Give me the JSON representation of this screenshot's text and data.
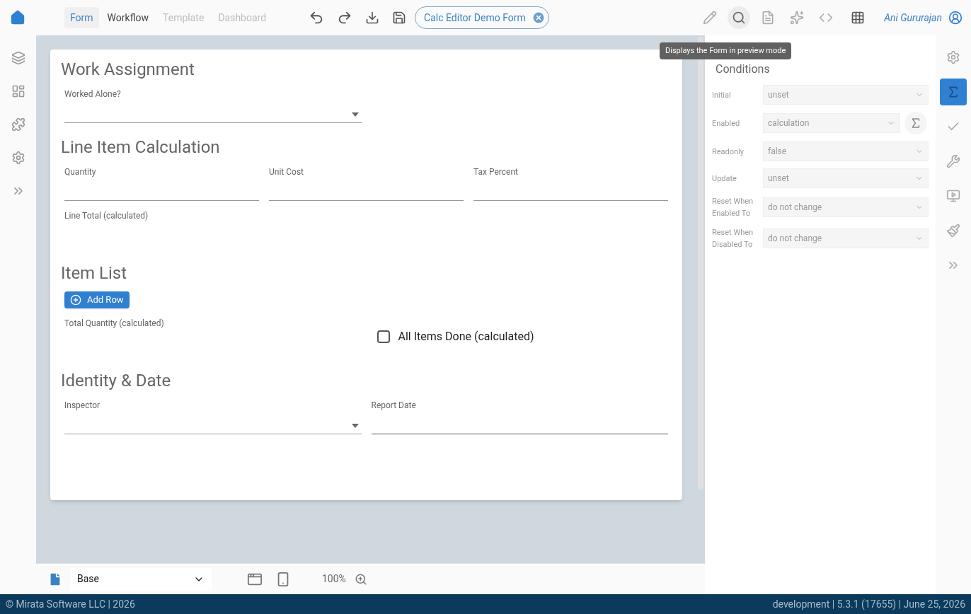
{
  "top_bar": {
    "tabs": [
      {
        "label": "Form",
        "selected": true,
        "disabled": false
      },
      {
        "label": "Workflow",
        "selected": false,
        "disabled": false
      },
      {
        "label": "Template",
        "selected": false,
        "disabled": true
      },
      {
        "label": "Dashboard",
        "selected": false,
        "disabled": true
      }
    ],
    "document": {
      "label": "Calc Editor Demo Form"
    },
    "tools": [
      {
        "selected": false
      },
      {
        "selected": true
      },
      {
        "selected": false
      },
      {
        "selected": false
      },
      {
        "selected": false
      }
    ],
    "user": {
      "name": "Ani Gururajan"
    },
    "tooltip": {
      "text": "Displays the Form in preview mode"
    }
  },
  "form": {
    "sections": [
      {
        "title": "Work Assignment",
        "rows": [
          [
            {
              "kind": "select",
              "label": "Worked Alone?"
            }
          ]
        ]
      },
      {
        "title": "Line Item Calculation",
        "rows": [
          [
            {
              "kind": "text",
              "label": "Quantity"
            },
            {
              "kind": "text",
              "label": "Unit Cost"
            },
            {
              "kind": "text",
              "label": "Tax Percent"
            }
          ],
          [
            {
              "kind": "calculated",
              "label": "Line Total (calculated)"
            }
          ]
        ]
      },
      {
        "title": "Item List",
        "rows": [
          [
            {
              "kind": "button",
              "label": "Add Row"
            }
          ],
          [
            {
              "kind": "calculated",
              "label": "Total Quantity (calculated)"
            },
            {
              "kind": "checkbox",
              "label": "All Items Done (calculated)",
              "checked": false
            }
          ]
        ]
      },
      {
        "title": "Identity & Date",
        "rows": [
          [
            {
              "kind": "select",
              "label": "Inspector"
            },
            {
              "kind": "date",
              "label": "Report Date"
            }
          ]
        ]
      }
    ]
  },
  "bottom_bar": {
    "layout": {
      "value": "Base"
    },
    "zoom": "100%"
  },
  "properties": {
    "title": "Conditions",
    "rows": [
      {
        "label": "Initial",
        "value": "unset",
        "calc_button": false
      },
      {
        "label": "Enabled",
        "value": "calculation",
        "calc_button": true
      },
      {
        "label": "Readonly",
        "value": "false",
        "calc_button": false
      },
      {
        "label": "Update",
        "value": "unset",
        "calc_button": false
      },
      {
        "label": "Reset When Enabled To",
        "value": "do not change",
        "calc_button": false
      },
      {
        "label": "Reset When Disabled To",
        "value": "do not change",
        "calc_button": false
      }
    ]
  },
  "right_rail": [
    {
      "selected": false
    },
    {
      "selected": true
    },
    {
      "selected": false
    },
    {
      "selected": false
    },
    {
      "selected": false
    },
    {
      "selected": false
    },
    {
      "selected": false
    }
  ],
  "footer": {
    "left": "© Mirata Software LLC | 2026",
    "right": "development | 5.3.1 (17655) | June 25, 2026"
  }
}
